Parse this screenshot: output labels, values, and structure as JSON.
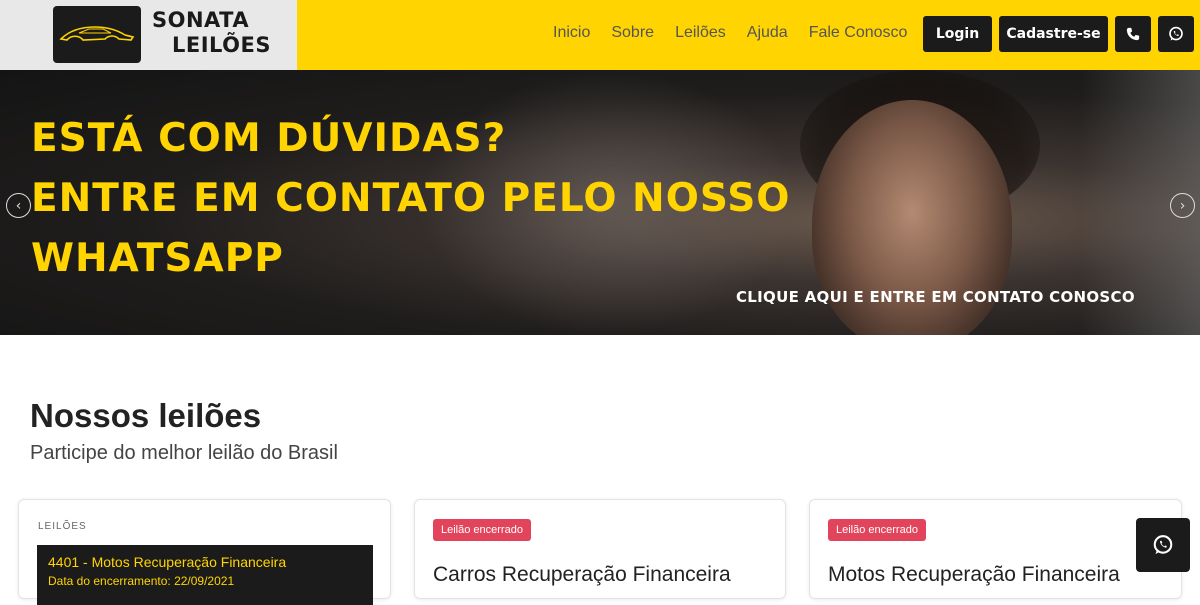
{
  "brand": {
    "line1": "SONATA",
    "line2": "LEILÕES",
    "icon": "car-silhouette-icon"
  },
  "nav": {
    "items": [
      {
        "label": "Inicio"
      },
      {
        "label": "Sobre"
      },
      {
        "label": "Leilões"
      },
      {
        "label": "Ajuda"
      },
      {
        "label": "Fale Conosco"
      }
    ],
    "login_label": "Login",
    "signup_label": "Cadastre-se",
    "phone_icon": "phone-icon",
    "whatsapp_icon": "whatsapp-icon"
  },
  "hero": {
    "line1": "ESTÁ COM DÚVIDAS?",
    "line2": "ENTRE EM CONTATO PELO NOSSO",
    "line3": "WHATSAPP",
    "cta": "CLIQUE AQUI E ENTRE EM CONTATO CONOSCO",
    "prev_icon": "chevron-left-icon",
    "next_icon": "chevron-right-icon"
  },
  "section": {
    "title": "Nossos leilões",
    "subtitle": "Participe do melhor leilão do Brasil"
  },
  "cards": [
    {
      "label": "LEILÕES",
      "item_title": "4401 - Motos Recuperação Financeira",
      "item_date": "Data do encerramento: 22/09/2021"
    },
    {
      "badge": "Leilão encerrado",
      "title": "Carros Recuperação Financeira"
    },
    {
      "badge": "Leilão encerrado",
      "title": "Motos Recuperação Financeira"
    }
  ],
  "floating": {
    "icon": "whatsapp-icon"
  },
  "colors": {
    "accent": "#ffd400",
    "dark": "#1b1b1b",
    "badge": "#e2445c"
  }
}
